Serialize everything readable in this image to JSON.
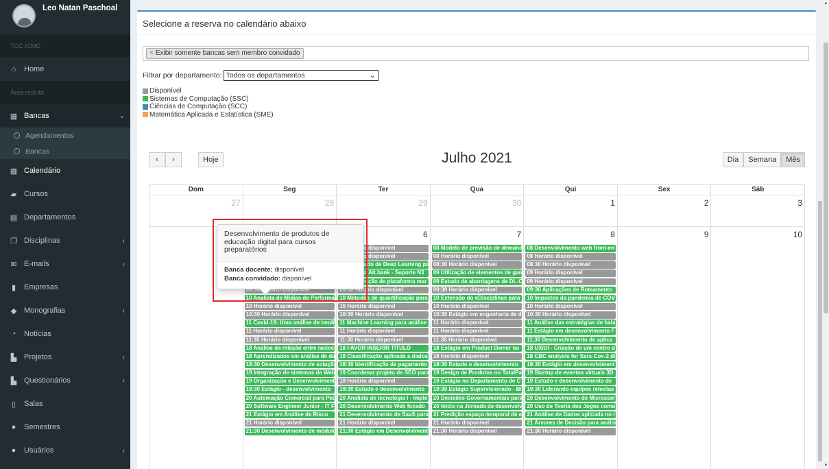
{
  "user": {
    "name": "Leo Natan Paschoal"
  },
  "sidebar": {
    "section1": "TCC ICMC",
    "home": "Home",
    "section2": "Área restrita",
    "bancas": "Bancas",
    "sub": [
      "Agendamentos",
      "Bancas"
    ],
    "items": [
      "Calendário",
      "Cursos",
      "Departamentos",
      "Disciplinas",
      "E-mails",
      "Empresas",
      "Monografias",
      "Notícias",
      "Projetos",
      "Questionários",
      "Salas",
      "Semestres",
      "Usuários"
    ]
  },
  "page": {
    "title": "Selecione a reserva no calendário abaixo",
    "chip": "Exibir somente bancas sem membro convidado",
    "chip_x": "×",
    "dept_label": "Filtrar por departamento:",
    "dept_value": "Todos os departamentos",
    "legend": [
      {
        "label": "Disponível",
        "color": "#999999"
      },
      {
        "label": "Sistemas de Computação (SSC)",
        "color": "#3db85a"
      },
      {
        "label": "Ciências de Computação (SCC)",
        "color": "#3c8dbc"
      },
      {
        "label": "Matemática Aplicada e Estatística (SME)",
        "color": "#f5a356"
      }
    ]
  },
  "calendar": {
    "title": "Julho 2021",
    "today": "Hoje",
    "views": [
      "Dia",
      "Semana",
      "Mês"
    ],
    "dow": [
      "Dom",
      "Seg",
      "Ter",
      "Qua",
      "Qui",
      "Sex",
      "Sáb"
    ],
    "week1": [
      "27",
      "28",
      "29",
      "30",
      "1",
      "2",
      "3"
    ],
    "week2": [
      "",
      "5",
      "6",
      "7",
      "8",
      "9",
      "10"
    ],
    "events": {
      "seg": [
        "",
        "",
        "",
        "09 Teste adaptação Multiestágio",
        "09 Desenvolvimento de produtos",
        "09:30 Horário disponível",
        "10 Analista de Mídias de Performance",
        "10 Horário disponível",
        "10:30 Horário disponível",
        "11 Covid-19: Uma análise de tendências",
        "11 Horário disponível",
        "11:30 Horário disponível",
        "18 Análise da relação entre raciocínio",
        "18 Aprendizados em análise de dados",
        "18:30 Desenvolvimento de solução",
        "19 Integração de sistemas de Web",
        "19 Organização e Desenvolvimento",
        "19:30 Estágio - desenvolvimento",
        "20 Automação Comercial para Pequenas",
        "20 Software Engineer Junior - IT F",
        "21 Estágio em Análise de Risco",
        "21 Horário disponível",
        "21:30 Desenvolvimento de módulo"
      ],
      "ter": [
        "08 Horário disponível",
        "08 Horário disponível",
        "08:30 Estudo de Deep Learning para",
        "09 Estágio Alt.bank - Suporte N3",
        "09 Construção de plataforma mar",
        "09:30 Horário disponível",
        "10 Métodos de quantificação para",
        "10 Horário disponível",
        "10:30 Horário disponível",
        "11 Machine Learning para análise",
        "11 Horário disponível",
        "11:30 Horário disponível",
        "18 FAVOR INSERIR TÍTULO",
        "18 Classificação aplicada a dados",
        "18:30 Identificação de pagamento",
        "19 Coordenar projeto de SEO para",
        "19 Horário disponível",
        "19:30 Estudo e desenvolvimento",
        "20 Analista de tecnologia I - Imple",
        "20 Desenvolvimento Web focado",
        "21 Desenvolvimento de SaaS para",
        "21 Horário disponível",
        "21:30 Estágio em Desenvolvimento"
      ],
      "qua": [
        "08 Modelo de previsão de demanda",
        "08 Horário disponível",
        "08:30 Horário disponível",
        "09 Utilização de elementos de gam",
        "09 Estudo de abordagens de DL-C",
        "09:30 Horário disponível",
        "10 Extensão do eDisciplinas para",
        "10 Horário disponível",
        "10:30 Estágio em engenharia de d",
        "11 Horário disponível",
        "11 Horário disponível",
        "11:30 Horário disponível",
        "18 Estágio em Product Owner na",
        "18 Horário disponível",
        "18:30 Estudo e desenvolvimento",
        "19 Design de Produtos no TotalPa",
        "19 Estágio no Departamento de C",
        "19:30 Estágio Supervisionado - Bi",
        "20 Decisões Governamentais para",
        "20 Início na Jornada de desenvolv",
        "21 Predição espaço-temporal de e",
        "21 Horário disponível",
        "21:30 Horário disponível"
      ],
      "qui": [
        "08 Desenvolvimento web front-en",
        "08 Horário disponível",
        "08:30 Horário disponível",
        "09 Horário disponível",
        "09 Horário disponível",
        "09:30 Aplicações de Roteamento",
        "10 Impactos da pandemia de COV",
        "10 Horário disponível",
        "10:30 Horário disponível",
        "11 Análise das estratégias de bala",
        "11 Estágio em desenvolvimento F",
        "11:30 Desenvolvimento de aplica",
        "18 UX/UI - Criação de um centro d",
        "18 CBC analysis for Sars-Cov-2 dia",
        "18:30 Estágio em desenvolviment",
        "19 Startup de eventos virtuais 3D",
        "19 Estudo e desenvolvimento de",
        "19:30 Liderando equipes remotas",
        "20 Desenvolvimento de Microsser",
        "20 Uso de Teoria dos Jogos como",
        "21 Análise de Dados aplicada no r",
        "21 Árvores de Decisão para anális",
        "21:30 Horário disponível"
      ]
    },
    "grey_flags": {
      "seg": [
        0,
        0,
        0,
        1,
        1,
        1,
        0,
        1,
        1,
        0,
        1,
        1,
        0,
        0,
        0,
        0,
        0,
        0,
        0,
        0,
        0,
        1,
        0
      ],
      "ter": [
        1,
        1,
        0,
        0,
        0,
        1,
        0,
        1,
        1,
        0,
        1,
        1,
        0,
        0,
        0,
        0,
        1,
        0,
        0,
        0,
        0,
        1,
        0
      ],
      "qua": [
        0,
        1,
        1,
        0,
        0,
        1,
        0,
        1,
        1,
        1,
        1,
        1,
        0,
        1,
        0,
        0,
        0,
        0,
        0,
        0,
        0,
        1,
        1
      ],
      "qui": [
        0,
        1,
        1,
        1,
        1,
        0,
        0,
        1,
        1,
        0,
        0,
        0,
        0,
        0,
        0,
        0,
        0,
        0,
        0,
        0,
        0,
        0,
        1
      ]
    }
  },
  "popover": {
    "title": "Desenvolvimento de produtos de educação digital para cursos preparatórios",
    "docente_label": "Banca docente:",
    "docente_value": " disponível",
    "convidado_label": "Banca convidado:",
    "convidado_value": " disponível"
  }
}
